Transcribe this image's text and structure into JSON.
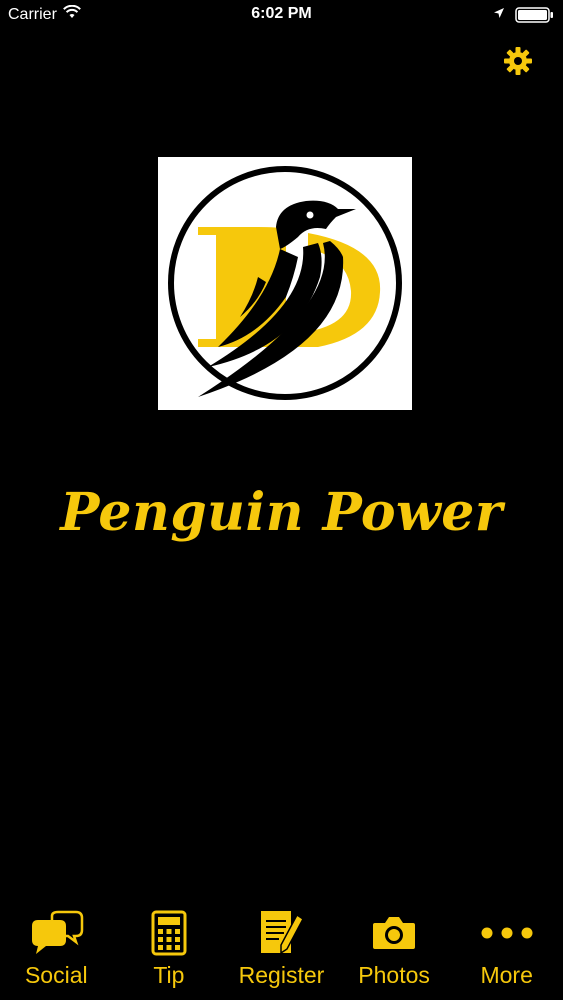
{
  "status_bar": {
    "carrier": "Carrier",
    "time": "6:02 PM",
    "icons": [
      "wifi-icon",
      "location-arrow-icon",
      "battery-icon"
    ]
  },
  "header": {
    "settings_icon": "gear-icon"
  },
  "app": {
    "title": "Penguin Power",
    "logo": "penguin-d-logo"
  },
  "tab_bar": {
    "items": [
      {
        "label": "Social",
        "icon": "chat-bubbles-icon"
      },
      {
        "label": "Tip",
        "icon": "calculator-icon"
      },
      {
        "label": "Register",
        "icon": "document-pen-icon"
      },
      {
        "label": "Photos",
        "icon": "camera-icon"
      },
      {
        "label": "More",
        "icon": "more-dots-icon"
      }
    ]
  },
  "colors": {
    "background": "#000000",
    "accent": "#f6c80c",
    "logo_background": "#ffffff"
  }
}
